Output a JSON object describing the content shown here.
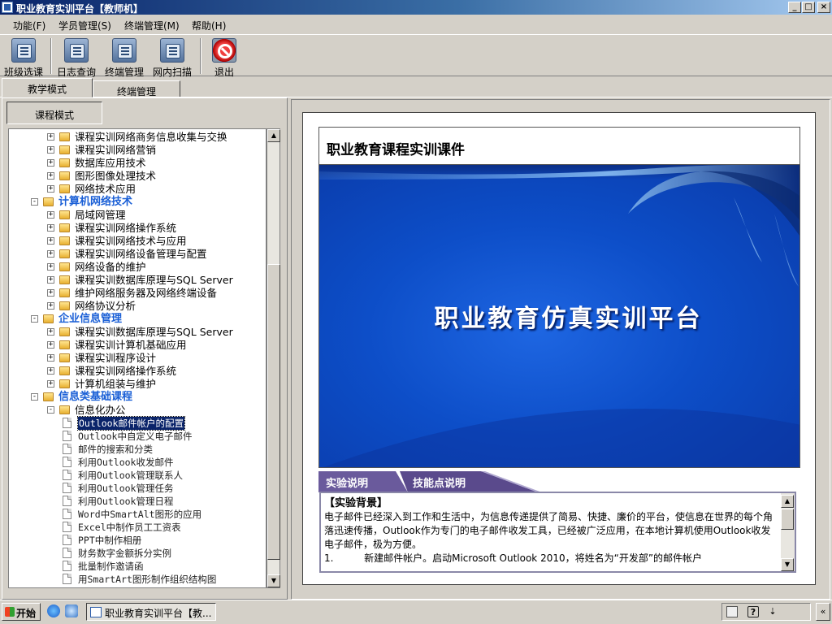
{
  "window": {
    "title": "职业教育实训平台【教师机】"
  },
  "window_controls": {
    "minimize": "_",
    "maximize": "□",
    "close": "×"
  },
  "menu": [
    "功能(F)",
    "学员管理(S)",
    "终端管理(M)",
    "帮助(H)"
  ],
  "toolbar": {
    "class_select": "班级选课",
    "log_query": "日志查询",
    "terminal_manage": "终端管理",
    "lan_scan": "网内扫描",
    "exit": "退出"
  },
  "tabs": {
    "teaching_mode": "教学模式",
    "terminal_manage": "终端管理"
  },
  "left": {
    "course_mode": "课程模式"
  },
  "tree": [
    {
      "text": "课程实训网络商务信息收集与交换",
      "level": 1,
      "type": "folder",
      "exp": "+"
    },
    {
      "text": "课程实训网络营销",
      "level": 1,
      "type": "folder",
      "exp": "+"
    },
    {
      "text": "数据库应用技术",
      "level": 1,
      "type": "folder",
      "exp": "+"
    },
    {
      "text": "图形图像处理技术",
      "level": 1,
      "type": "folder",
      "exp": "+"
    },
    {
      "text": "网络技术应用",
      "level": 1,
      "type": "folder",
      "exp": "+"
    },
    {
      "text": "计算机网络技术",
      "level": 0,
      "type": "category",
      "exp": "−"
    },
    {
      "text": "局域网管理",
      "level": 1,
      "type": "folder",
      "exp": "+"
    },
    {
      "text": "课程实训网络操作系统",
      "level": 1,
      "type": "folder",
      "exp": "+"
    },
    {
      "text": "课程实训网络技术与应用",
      "level": 1,
      "type": "folder",
      "exp": "+"
    },
    {
      "text": "课程实训网络设备管理与配置",
      "level": 1,
      "type": "folder",
      "exp": "+"
    },
    {
      "text": "网络设备的维护",
      "level": 1,
      "type": "folder",
      "exp": "+"
    },
    {
      "text": "课程实训数据库原理与SQL Server",
      "level": 1,
      "type": "folder",
      "exp": "+"
    },
    {
      "text": "维护网络服务器及网络终端设备",
      "level": 1,
      "type": "folder",
      "exp": "+"
    },
    {
      "text": "网络协议分析",
      "level": 1,
      "type": "folder",
      "exp": "+"
    },
    {
      "text": "企业信息管理",
      "level": 0,
      "type": "category",
      "exp": "−"
    },
    {
      "text": "课程实训数据库原理与SQL Server",
      "level": 1,
      "type": "folder",
      "exp": "+"
    },
    {
      "text": "课程实训计算机基础应用",
      "level": 1,
      "type": "folder",
      "exp": "+"
    },
    {
      "text": "课程实训程序设计",
      "level": 1,
      "type": "folder",
      "exp": "+"
    },
    {
      "text": "课程实训网络操作系统",
      "level": 1,
      "type": "folder",
      "exp": "+"
    },
    {
      "text": "计算机组装与维护",
      "level": 1,
      "type": "folder",
      "exp": "+"
    },
    {
      "text": "信息类基础课程",
      "level": 0,
      "type": "category",
      "exp": "−"
    },
    {
      "text": "信息化办公",
      "level": 1,
      "type": "folder",
      "exp": "−"
    },
    {
      "text": "Outlook邮件帐户的配置",
      "level": 2,
      "type": "doc",
      "selected": true
    },
    {
      "text": "Outlook中自定义电子邮件",
      "level": 2,
      "type": "doc"
    },
    {
      "text": "邮件的搜索和分类",
      "level": 2,
      "type": "doc"
    },
    {
      "text": "利用Outlook收发邮件",
      "level": 2,
      "type": "doc"
    },
    {
      "text": "利用Outlook管理联系人",
      "level": 2,
      "type": "doc"
    },
    {
      "text": "利用Outlook管理任务",
      "level": 2,
      "type": "doc"
    },
    {
      "text": "利用Outlook管理日程",
      "level": 2,
      "type": "doc"
    },
    {
      "text": "Word中SmartAlt图形的应用",
      "level": 2,
      "type": "doc"
    },
    {
      "text": "Excel中制作员工工资表",
      "level": 2,
      "type": "doc"
    },
    {
      "text": "PPT中制作相册",
      "level": 2,
      "type": "doc"
    },
    {
      "text": "财务数字金额拆分实例",
      "level": 2,
      "type": "doc"
    },
    {
      "text": "批量制作邀请函",
      "level": 2,
      "type": "doc"
    },
    {
      "text": "用SmartArt图形制作组织结构图",
      "level": 2,
      "type": "doc"
    }
  ],
  "content": {
    "header_title": "职业教育课程实训课件",
    "banner_text": "职业教育仿真实训平台",
    "tab_experiment": "实验说明",
    "tab_skills": "技能点说明",
    "section_title": "【实验背景】",
    "paragraph": "电子邮件已经深入到工作和生活中，为信息传递提供了简易、快捷、廉价的平台，使信息在世界的每个角落迅速传播，Outlook作为专门的电子邮件收发工具，已经被广泛应用，在本地计算机使用Outlook收发电子邮件，极为方便。",
    "step1_num": "1.",
    "step1_text": "新建邮件帐户。启动Microsoft Outlook 2010，将姓名为“开发部”的邮件帐户"
  },
  "taskbar": {
    "start": "开始",
    "task_title": "职业教育实训平台【教...",
    "tray_chevron": "«"
  },
  "colors": {
    "category": "#1a5fd6",
    "selection": "#0a246a",
    "banner": "#0d4ec8",
    "tab_purple": "#5a4a8c"
  }
}
